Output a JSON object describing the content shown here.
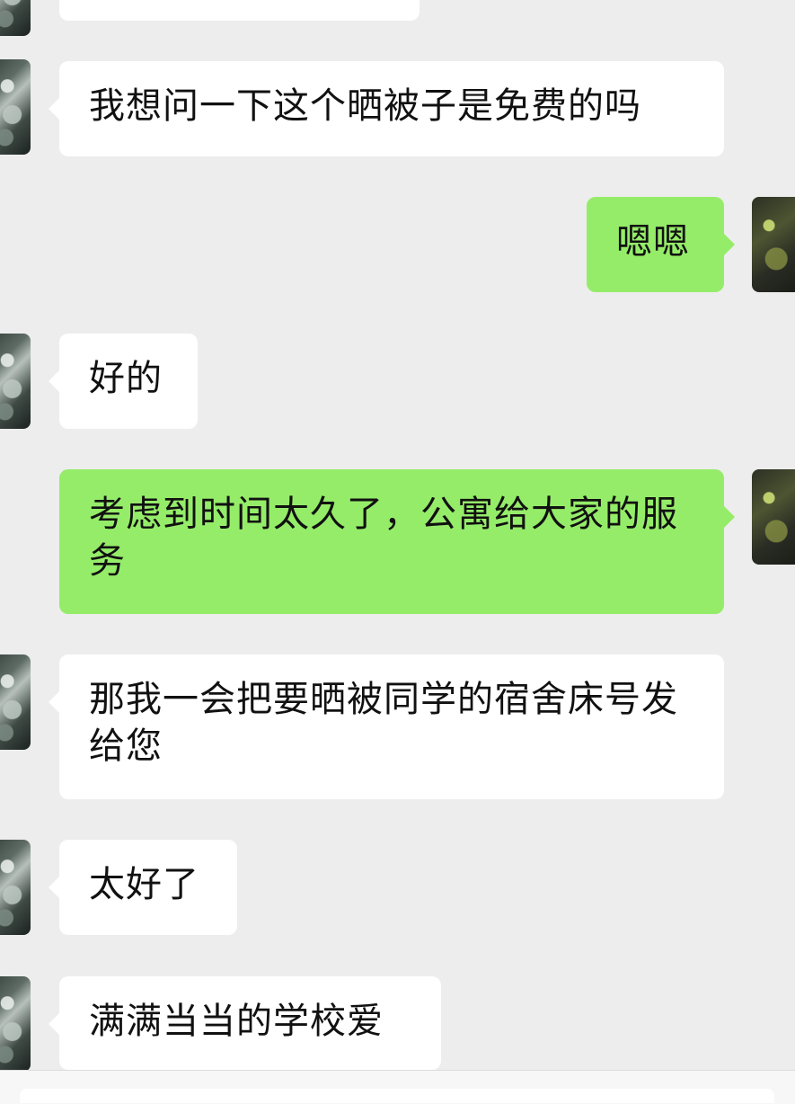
{
  "messages": [
    {
      "side": "left",
      "text": ""
    },
    {
      "side": "left",
      "text": "我想问一下这个晒被子是免费的吗"
    },
    {
      "side": "right",
      "text": "嗯嗯"
    },
    {
      "side": "left",
      "text": "好的"
    },
    {
      "side": "right",
      "text": "考虑到时间太久了，公寓给大家的服务"
    },
    {
      "side": "left",
      "text": "那我一会把要晒被同学的宿舍床号发给您"
    },
    {
      "side": "left",
      "text": "太好了"
    },
    {
      "side": "left",
      "text": "满满当当的学校爱"
    }
  ]
}
